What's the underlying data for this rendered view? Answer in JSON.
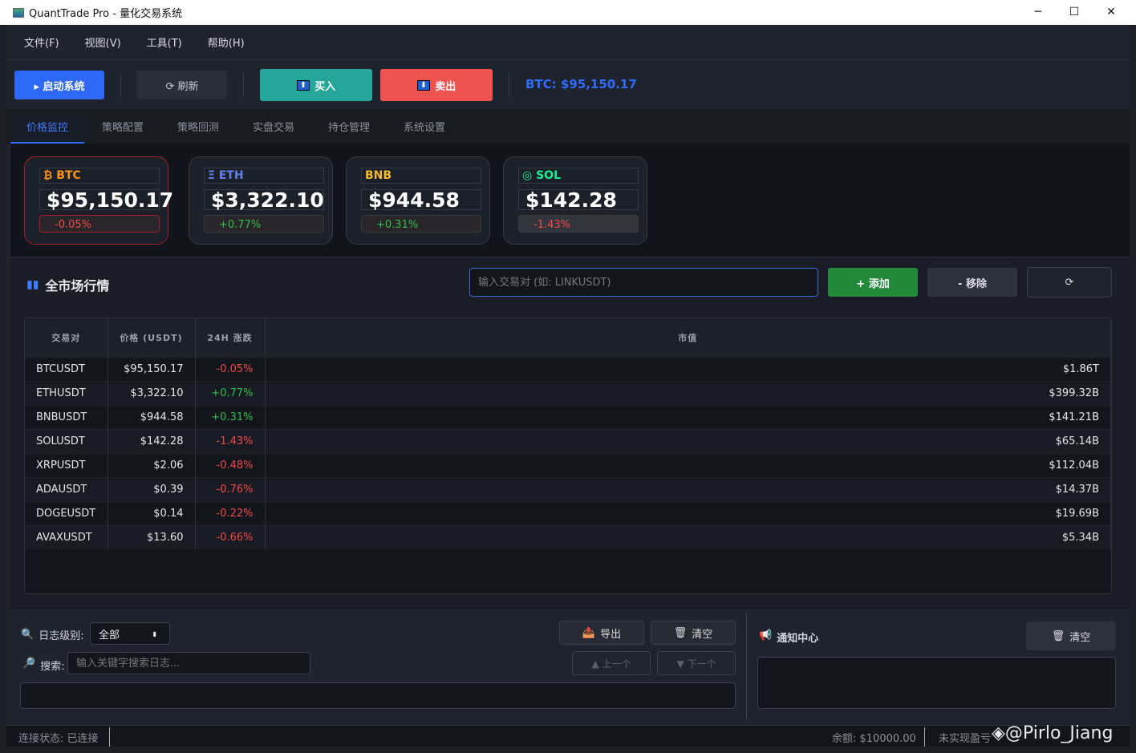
{
  "window": {
    "title": "QuantTrade Pro - 量化交易系统",
    "minimize": "─",
    "maximize": "☐",
    "close": "✕"
  },
  "menu": [
    "文件(F)",
    "视图(V)",
    "工具(T)",
    "帮助(H)"
  ],
  "toolbar": {
    "start": "▸ 启动系统",
    "refresh": "⟳ 刷新",
    "buy": "买入",
    "sell": "卖出",
    "btc_price": "BTC: $95,150.17",
    "colors": {
      "start": "#2d68f8",
      "buy": "#26a69a",
      "sell": "#ef5350"
    }
  },
  "tabs": [
    "价格监控",
    "策略配置",
    "策略回测",
    "实盘交易",
    "持仓管理",
    "系统设置"
  ],
  "cards": [
    {
      "symbol": "₿ BTC",
      "price": "$95,150.17",
      "change": "-0.05%",
      "color": "#f7931a"
    },
    {
      "symbol": "Ξ ETH",
      "price": "$3,322.10",
      "change": "+0.77%",
      "color": "#627eea"
    },
    {
      "symbol": "BNB",
      "price": "$944.58",
      "change": "+0.31%",
      "color": "#f3ba2f"
    },
    {
      "symbol": "◎ SOL",
      "price": "$142.28",
      "change": "-1.43%",
      "color": "#14f195"
    }
  ],
  "market": {
    "title": "全市场行情",
    "search_placeholder": "输入交易对 (如: LINKUSDT)",
    "add": "+ 添加",
    "remove": "- 移除",
    "refresh": "⟳",
    "columns": [
      "交易对",
      "价格 (USDT)",
      "24H 涨跌",
      "市值"
    ],
    "rows": [
      [
        "BTCUSDT",
        "$95,150.17",
        "-0.05%",
        "$1.86T"
      ],
      [
        "ETHUSDT",
        "$3,322.10",
        "+0.77%",
        "$399.32B"
      ],
      [
        "BNBUSDT",
        "$944.58",
        "+0.31%",
        "$141.21B"
      ],
      [
        "SOLUSDT",
        "$142.28",
        "-1.43%",
        "$65.14B"
      ],
      [
        "XRPUSDT",
        "$2.06",
        "-0.48%",
        "$112.04B"
      ],
      [
        "ADAUSDT",
        "$0.39",
        "-0.76%",
        "$14.37B"
      ],
      [
        "DOGEUSDT",
        "$0.14",
        "-0.22%",
        "$19.69B"
      ],
      [
        "AVAXUSDT",
        "$13.60",
        "-0.66%",
        "$5.34B"
      ]
    ]
  },
  "log": {
    "level_label": "日志级别:",
    "level_value": "全部",
    "search_label": "搜索:",
    "search_placeholder": "输入关键字搜索日志...",
    "export": "导出",
    "clear": "清空",
    "prev": "▲ 上一个",
    "next": "▼ 下一个"
  },
  "notify": {
    "title": "通知中心",
    "clear": "清空"
  },
  "status": {
    "connection": "连接状态: 已连接",
    "balance": "余额: $10000.00",
    "pnl": "未实现盈亏",
    "watermark": "@Pirlo_Jiang"
  }
}
